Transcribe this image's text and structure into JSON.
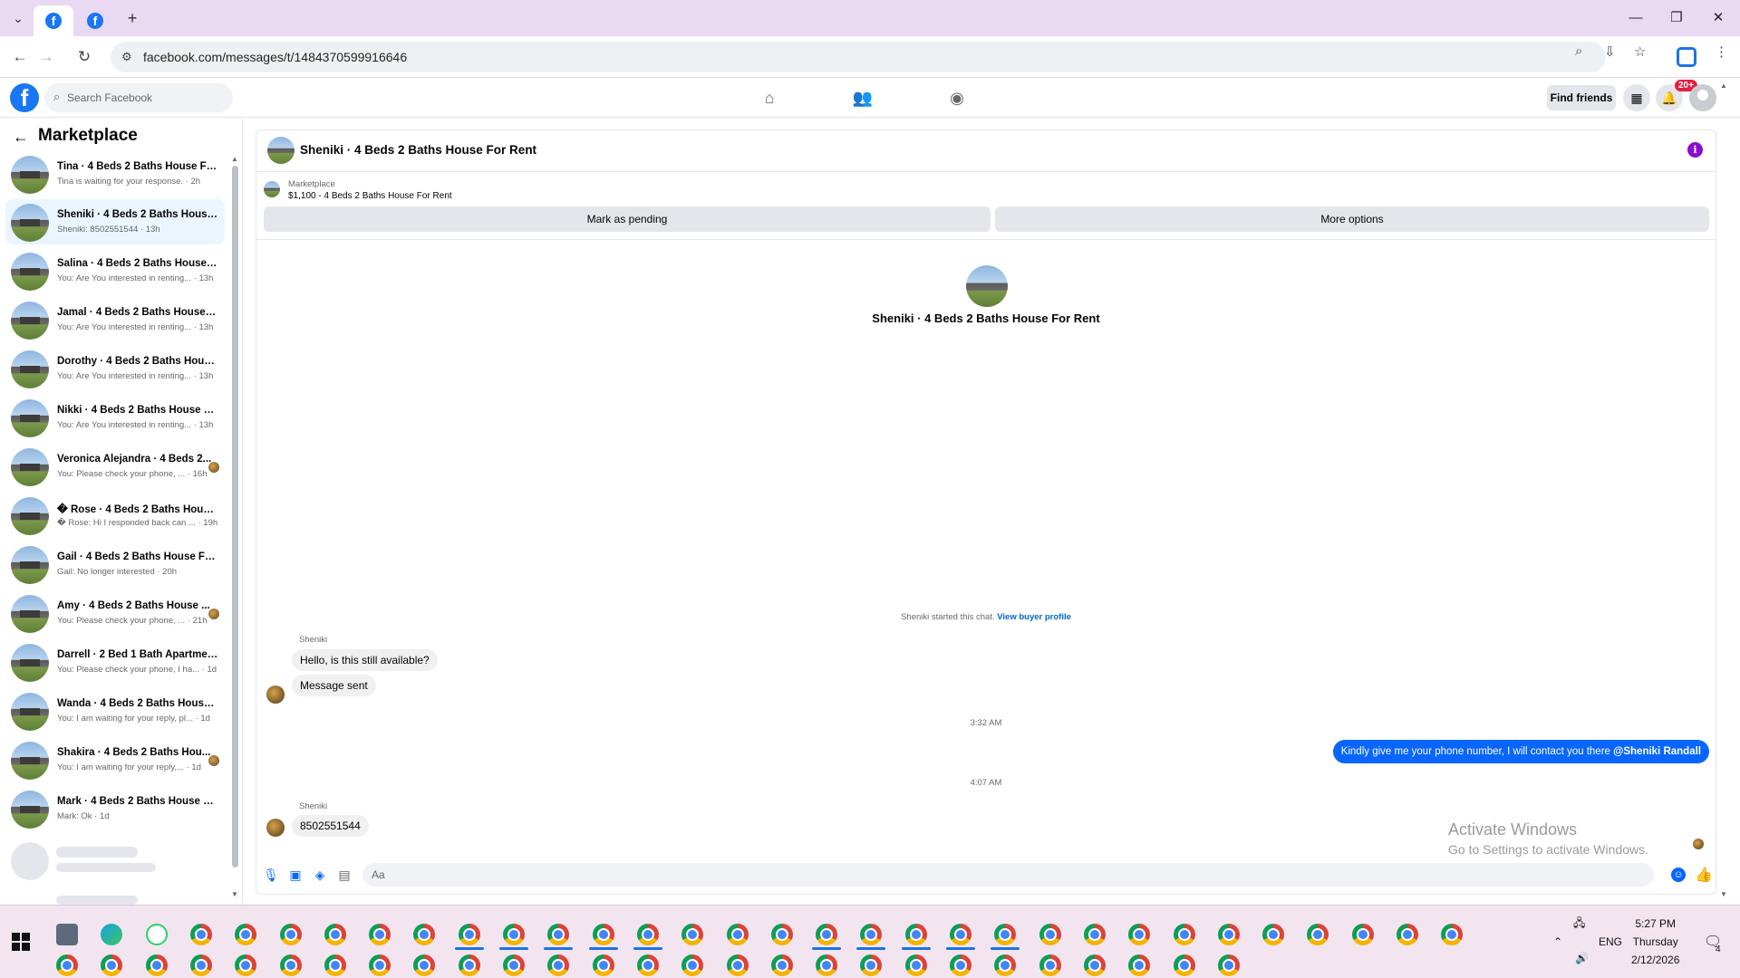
{
  "browser": {
    "url": "facebook.com/messages/t/1484370599916646",
    "new_tab": "+",
    "tab_list": "⌄",
    "win_min": "—",
    "win_restore": "❐",
    "win_close": "✕",
    "tab_favicon_letter": "f"
  },
  "fb_header": {
    "logo_letter": "f",
    "search_placeholder": "Search Facebook",
    "find_friends": "Find friends",
    "notif_badge": "20+"
  },
  "sidebar": {
    "title": "Marketplace",
    "conversations": [
      {
        "name": "Tina · 4 Beds 2 Baths House For...",
        "sub": "Tina is waiting for your response. · 2h",
        "dot": false
      },
      {
        "name": "Sheniki · 4 Beds 2 Baths House ...",
        "sub": "Sheniki: 8502551544 · 13h",
        "dot": false,
        "active": true
      },
      {
        "name": "Salina · 4 Beds 2 Baths House F...",
        "sub": "You: Are You interested in renting... · 13h",
        "dot": false
      },
      {
        "name": "Jamal · 4 Beds 2 Baths House F...",
        "sub": "You: Are You interested in renting... · 13h",
        "dot": false
      },
      {
        "name": "Dorothy · 4 Beds 2 Baths House...",
        "sub": "You: Are You interested in renting... · 13h",
        "dot": false
      },
      {
        "name": "Nikki · 4 Beds 2 Baths House Fo...",
        "sub": "You: Are You interested in renting... · 13h",
        "dot": false
      },
      {
        "name": "Veronica Alejandra · 4 Beds 2...",
        "sub": "You: Please check your phone, ... · 16h",
        "dot": true
      },
      {
        "name": "� Rose · 4 Beds 2 Baths House ...",
        "sub": "� Rose: Hi I responded back can ... · 19h",
        "dot": false
      },
      {
        "name": "Gail · 4 Beds 2 Baths House For ...",
        "sub": "Gail: No longer interested · 20h",
        "dot": false
      },
      {
        "name": "Amy · 4 Beds 2 Baths House ...",
        "sub": "You: Please check your phone, ... · 21h",
        "dot": true
      },
      {
        "name": "Darrell · 2 Bed 1 Bath Apartmen...",
        "sub": "You: Please check your phone, I ha... · 1d",
        "dot": false
      },
      {
        "name": "Wanda · 4 Beds 2 Baths House ...",
        "sub": "You: I am waiting for your reply, pl... · 1d",
        "dot": false
      },
      {
        "name": "Shakira · 4 Beds 2 Baths Hou...",
        "sub": "You: I am waiting for your reply,... · 1d",
        "dot": true
      },
      {
        "name": "Mark · 4 Beds 2 Baths House Fo...",
        "sub": "Mark: Ok · 1d",
        "dot": false
      }
    ]
  },
  "chat": {
    "title": "Sheniki · 4 Beds 2 Baths House For Rent",
    "marketplace_label": "Marketplace",
    "listing": "$1,100 - 4 Beds 2 Baths House For Rent",
    "mark_pending": "Mark as pending",
    "more_options": "More options",
    "intro_title": "Sheniki · 4 Beds 2 Baths House For Rent",
    "started_text": "Sheniki started this chat.",
    "view_profile": "View buyer profile",
    "sender1": "Sheniki",
    "msg1": "Hello, is this still available?",
    "msg2": "Message sent",
    "time1": "3:32 AM",
    "out_msg": "Kindly give me your phone number, I will contact you there",
    "out_mention": "@Sheniki Randall",
    "time2": "4:07 AM",
    "sender2": "Sheniki",
    "msg3": "8502551544",
    "composer_placeholder": "Aa"
  },
  "watermark": {
    "line1": "Activate Windows",
    "line2": "Go to Settings to activate Windows."
  },
  "taskbar": {
    "lang": "ENG",
    "time": "5:27 PM",
    "day": "Thursday",
    "date": "2/12/2026",
    "notif_count": "4"
  }
}
